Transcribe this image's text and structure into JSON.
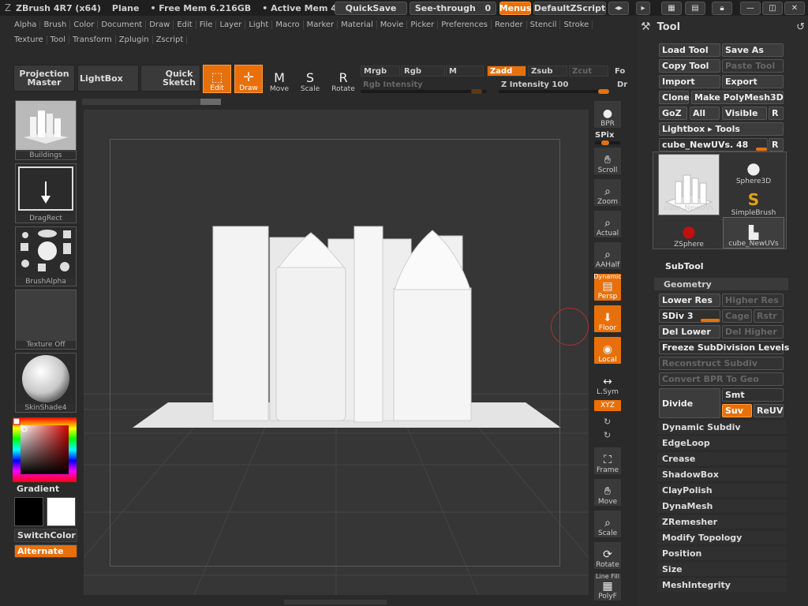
{
  "titlebar": {
    "app": "ZBrush 4R7 (x64)",
    "doc": "Plane",
    "free_mem": "• Free Mem 6.216GB",
    "active_mem": "• Active Mem 4",
    "quicksave": "QuickSave",
    "seethrough": "See-through",
    "seethrough_value": "0",
    "menus": "Menus",
    "zscript": "DefaultZScript"
  },
  "menus": {
    "row1": [
      "Alpha",
      "Brush",
      "Color",
      "Document",
      "Draw",
      "Edit",
      "File",
      "Layer",
      "Light",
      "Macro",
      "Marker",
      "Material",
      "Movie",
      "Picker",
      "Preferences",
      "Render",
      "Stencil",
      "Stroke"
    ],
    "row2": [
      "Texture",
      "Tool",
      "Transform",
      "Zplugin",
      "Zscript"
    ]
  },
  "toolbar": {
    "projection_master": "Projection Master",
    "lightbox": "LightBox",
    "quick_sketch": "Quick Sketch",
    "edit": "Edit",
    "draw": "Draw",
    "move": "Move",
    "scale": "Scale",
    "rotate": "Rotate",
    "mrgb": "Mrgb",
    "rgb": "Rgb",
    "m": "M",
    "zadd": "Zadd",
    "zsub": "Zsub",
    "zcut": "Zcut",
    "fo": "Fo",
    "rgb_intensity": "Rgb Intensity",
    "z_intensity": "Z Intensity 100",
    "dr": "Dr"
  },
  "left_shelf": {
    "brush": "Buildings",
    "stroke": "DragRect",
    "alpha": "BrushAlpha",
    "texture": "Texture Off",
    "material": "SkinShade4",
    "gradient": "Gradient",
    "switch_color": "SwitchColor",
    "alternate": "Alternate"
  },
  "right_shelf": {
    "bpr": "BPR",
    "spix": "SPix",
    "scroll": "Scroll",
    "zoom": "Zoom",
    "actual": "Actual",
    "aahalf": "AAHalf",
    "dynamic": "Dynamic",
    "persp": "Persp",
    "floor": "Floor",
    "local": "Local",
    "lsym": "L.Sym",
    "xyz": "XYZ",
    "frame": "Frame",
    "move": "Move",
    "scale": "Scale",
    "rotate": "Rotate",
    "line_fill": "Line Fill",
    "polyf": "PolyF"
  },
  "tool_panel": {
    "title": "Tool",
    "load_tool": "Load Tool",
    "save_as": "Save As",
    "copy_tool": "Copy Tool",
    "paste_tool": "Paste Tool",
    "import": "Import",
    "export": "Export",
    "clone": "Clone",
    "make_polymesh": "Make PolyMesh3D",
    "goz": "GoZ",
    "all": "All",
    "visible": "Visible",
    "r": "R",
    "lightbox_tools": "Lightbox ▸ Tools",
    "current_tool": "cube_NewUVs. 48",
    "tools": [
      "cube_NewUVs",
      "Sphere3D",
      "SimpleBrush",
      "ZSphere",
      "cube_NewUVs"
    ],
    "subtool": "SubTool",
    "geometry": "Geometry",
    "lower_res": "Lower Res",
    "higher_res": "Higher Res",
    "sdiv": "SDiv 3",
    "cage": "Cage",
    "rstr": "Rstr",
    "del_lower": "Del Lower",
    "del_higher": "Del Higher",
    "freeze": "Freeze SubDivision Levels",
    "reconstruct": "Reconstruct Subdiv",
    "convert_bpr": "Convert BPR To Geo",
    "divide": "Divide",
    "smt": "Smt",
    "suv": "Suv",
    "reuv": "ReUV",
    "submenus": [
      "Dynamic Subdiv",
      "EdgeLoop",
      "Crease",
      "ShadowBox",
      "ClayPolish",
      "DynaMesh",
      "ZRemesher",
      "Modify Topology",
      "Position",
      "Size",
      "MeshIntegrity"
    ]
  },
  "colors": {
    "accent": "#e8700a",
    "panel": "#2c2c2c",
    "canvas": "#363636"
  }
}
